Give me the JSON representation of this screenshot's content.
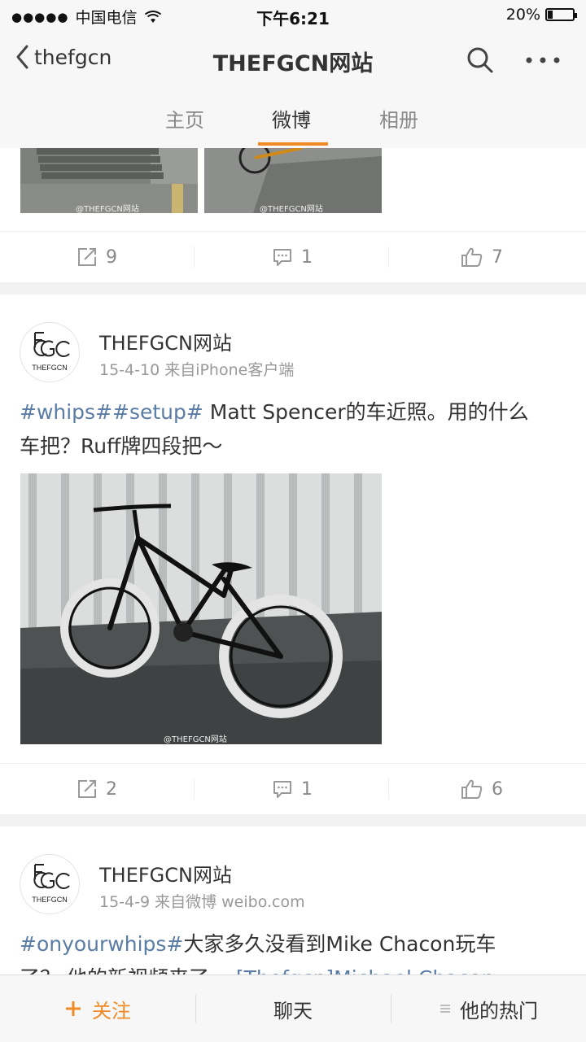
{
  "status_bar": {
    "carrier": "中国电信",
    "time": "下午6:21",
    "battery": "20%",
    "battery_level": 0.2
  },
  "nav": {
    "back_label": "thefgcn",
    "title": "THEFGCN网站",
    "search_icon": "search-icon",
    "more_icon": "more-icon"
  },
  "tabs": [
    {
      "label": "主页"
    },
    {
      "label": "微博",
      "active": true
    },
    {
      "label": "相册"
    }
  ],
  "posts": [
    {
      "watermark": "@THEFGCN网站",
      "actions": {
        "repost": "9",
        "comment": "1",
        "like": "7"
      }
    },
    {
      "author": "THEFGCN网站",
      "meta": "15-4-10  来自iPhone客户端",
      "avatar_text": "THEFGCN",
      "text_tag": "#whips##setup#",
      "text_line1": " Matt Spencer的车近照。用的什么",
      "text_line2": "车把？Ruff牌四段把～",
      "watermark": "@THEFGCN网站",
      "actions": {
        "repost": "2",
        "comment": "1",
        "like": "6"
      }
    },
    {
      "author": "THEFGCN网站",
      "meta": "15-4-9  来自微博 weibo.com",
      "avatar_text": "THEFGCN",
      "text_tag": "#onyourwhips#",
      "text_line1": "大家多久没看到Mike Chacon玩车",
      "text_line2_prefix": "了？ 他的新视频来了。",
      "text_line2_link": "[Thefgcn]Michael Chacon"
    }
  ],
  "toolbar": {
    "follow": "关注",
    "chat": "聊天",
    "hot": "他的热门"
  },
  "colors": {
    "accent": "#f08a24",
    "topic_link": "#5a7ca5"
  }
}
